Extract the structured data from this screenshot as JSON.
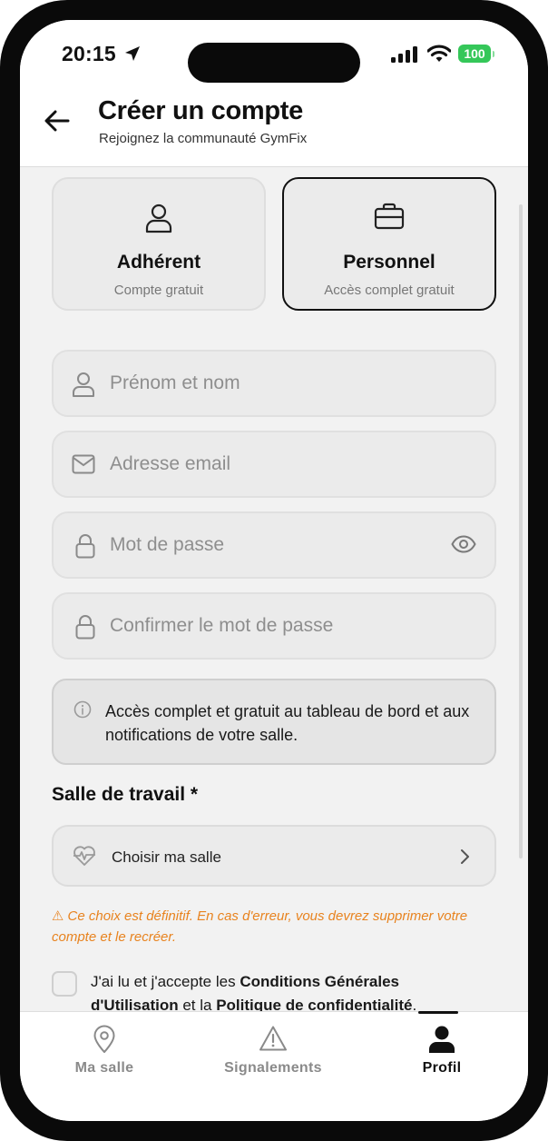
{
  "status_bar": {
    "time": "20:15",
    "battery": "100"
  },
  "header": {
    "back_icon": "arrow-left-icon",
    "title": "Créer un compte",
    "subtitle": "Rejoignez la communauté GymFix"
  },
  "roles": [
    {
      "icon": "user-icon",
      "name": "Adhérent",
      "description": "Compte gratuit",
      "selected": false
    },
    {
      "icon": "briefcase-icon",
      "name": "Personnel",
      "description": "Accès complet gratuit",
      "selected": true
    }
  ],
  "form": {
    "fullname": {
      "icon": "user-icon",
      "placeholder": "Prénom et nom",
      "value": ""
    },
    "email": {
      "icon": "mail-icon",
      "placeholder": "Adresse email",
      "value": ""
    },
    "password": {
      "icon": "lock-icon",
      "placeholder": "Mot de passe",
      "value": "",
      "toggle_icon": "eye-icon"
    },
    "confirm_password": {
      "icon": "lock-icon",
      "placeholder": "Confirmer le mot de passe",
      "value": ""
    }
  },
  "info_box": {
    "icon": "info-icon",
    "text": "Accès complet et gratuit au tableau de bord et aux notifications de votre salle."
  },
  "gym": {
    "section_title": "Salle de travail *",
    "select_icon": "heart-pulse-icon",
    "select_label": "Choisir ma salle",
    "warning": "⚠ Ce choix est définitif. En cas d'erreur, vous devrez supprimer votre compte et le recréer."
  },
  "terms": {
    "checked": false,
    "prefix": "J'ai lu et j'accepte les ",
    "cgu": "Conditions Générales d'Utilisation",
    "middle": " et la ",
    "privacy": "Politique de confidentialité",
    "suffix": "."
  },
  "tabbar": [
    {
      "icon": "map-pin-icon",
      "label": "Ma salle",
      "active": false
    },
    {
      "icon": "warning-icon",
      "label": "Signalements",
      "active": false
    },
    {
      "icon": "user-solid-icon",
      "label": "Profil",
      "active": true
    }
  ],
  "colors": {
    "accent": "#111111",
    "warning": "#e8831f",
    "battery": "#35c759"
  }
}
